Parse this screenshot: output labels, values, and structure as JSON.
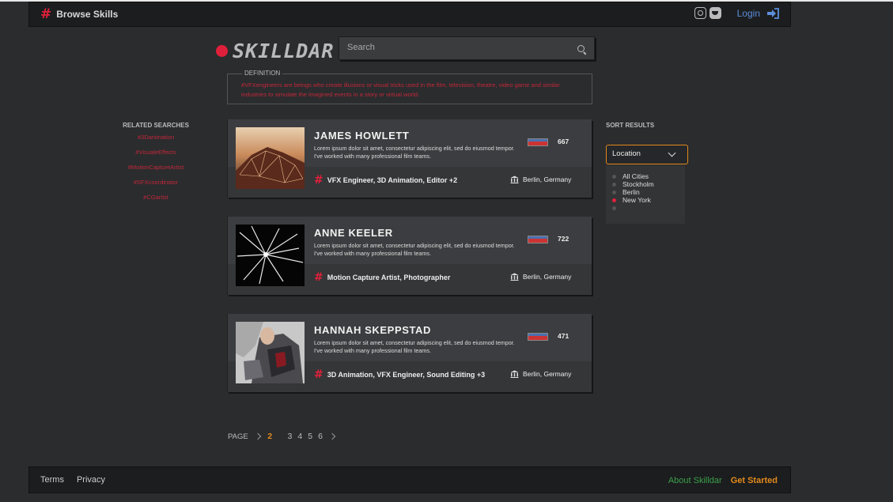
{
  "topbar": {
    "brand_label": "Browse Skills",
    "login_label": "Login",
    "icons": [
      "instagram-icon",
      "twitter-icon",
      "login-icon"
    ]
  },
  "logo": {
    "text": "SKILLDAR"
  },
  "search": {
    "placeholder": "Search",
    "value": ""
  },
  "definition": {
    "label": "DEFINITION",
    "text": "#VFXengineers are beings who create illusions or visual tricks used in the film, television, theatre, video game and similar industries to simulate the imagined events in a story or virtual world."
  },
  "related": {
    "title": "RELATED SEARCHES",
    "items": [
      "#3Danimation",
      "#VisualeEffects",
      "#MotionCaptureArtist",
      "#SFXcoordinator",
      "#CGartist"
    ]
  },
  "sort": {
    "title": "SORT RESULTS",
    "selected": "Location",
    "cities": [
      {
        "label": "All Cities",
        "state": "normal"
      },
      {
        "label": "Stockholm",
        "state": "normal"
      },
      {
        "label": "Berlin",
        "state": "normal"
      },
      {
        "label": "New York",
        "state": "active"
      }
    ]
  },
  "profiles": [
    {
      "name": "JAMES HOWLETT",
      "description": "Lorem ipsum dolor sit amet, consectetur adipiscing elit, sed do eiusmod tempor. I've worked with many professional film teams.",
      "score": "667",
      "skills": "VFX Engineer, 3D Animation, Editor +2",
      "location": "Berlin, Germany"
    },
    {
      "name": "ANNE KEELER",
      "description": "Lorem ipsum dolor sit amet, consectetur adipiscing elit, sed do eiusmod tempor. I've worked with many professional film teams.",
      "score": "722",
      "skills": "Motion Capture Artist, Photographer",
      "location": "Berlin, Germany"
    },
    {
      "name": "HANNAH SKEPPSTAD",
      "description": "Lorem ipsum dolor sit amet, consectetur adipiscing elit, sed do eiusmod tempor. I've worked with many professional film teams.",
      "score": "471",
      "skills": "3D Animation, VFX Engineer, Sound Editing +3",
      "location": "Berlin, Germany"
    }
  ],
  "pager": {
    "label": "PAGE",
    "current": "2",
    "pages": [
      "3",
      "4",
      "5",
      "6"
    ]
  },
  "footer": {
    "terms": "Terms",
    "privacy": "Privacy",
    "about": "About Skilldar",
    "get_started": "Get Started"
  },
  "colors": {
    "accent_red": "#e0203a",
    "accent_orange": "#e28a1b",
    "accent_green": "#3aa14a",
    "link_blue": "#5b8fd9"
  }
}
